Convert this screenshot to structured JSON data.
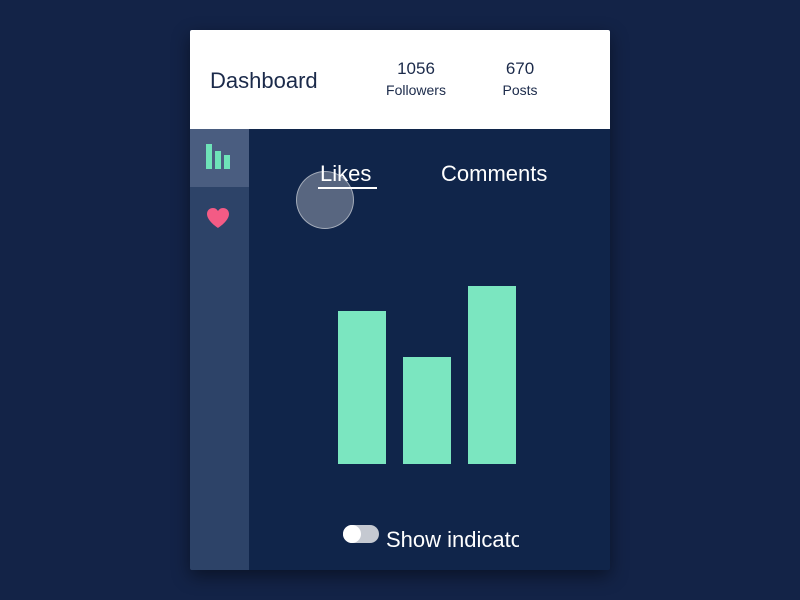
{
  "header": {
    "title": "Dashboard",
    "stats": [
      {
        "value": "1056",
        "label": "Followers"
      },
      {
        "value": "670",
        "label": "Posts"
      }
    ]
  },
  "sidebar": {
    "items": [
      {
        "icon": "bar-chart-icon",
        "active": true,
        "color": "#6ee3b8"
      },
      {
        "icon": "heart-icon",
        "active": false,
        "color": "#f35b85"
      }
    ]
  },
  "tabs": [
    {
      "label": "Likes",
      "active": true
    },
    {
      "label": "Comments",
      "active": false
    }
  ],
  "toggle": {
    "label": "Show indicators",
    "on": false
  },
  "colors": {
    "background": "#132347",
    "panel": "#10254a",
    "sidebar": "#2d4368",
    "bar": "#7be6c0",
    "text": "#ffffff"
  },
  "chart_data": {
    "type": "bar",
    "categories": [
      "",
      "",
      ""
    ],
    "values": [
      153,
      107,
      178
    ],
    "ylim": [
      0,
      178
    ]
  }
}
